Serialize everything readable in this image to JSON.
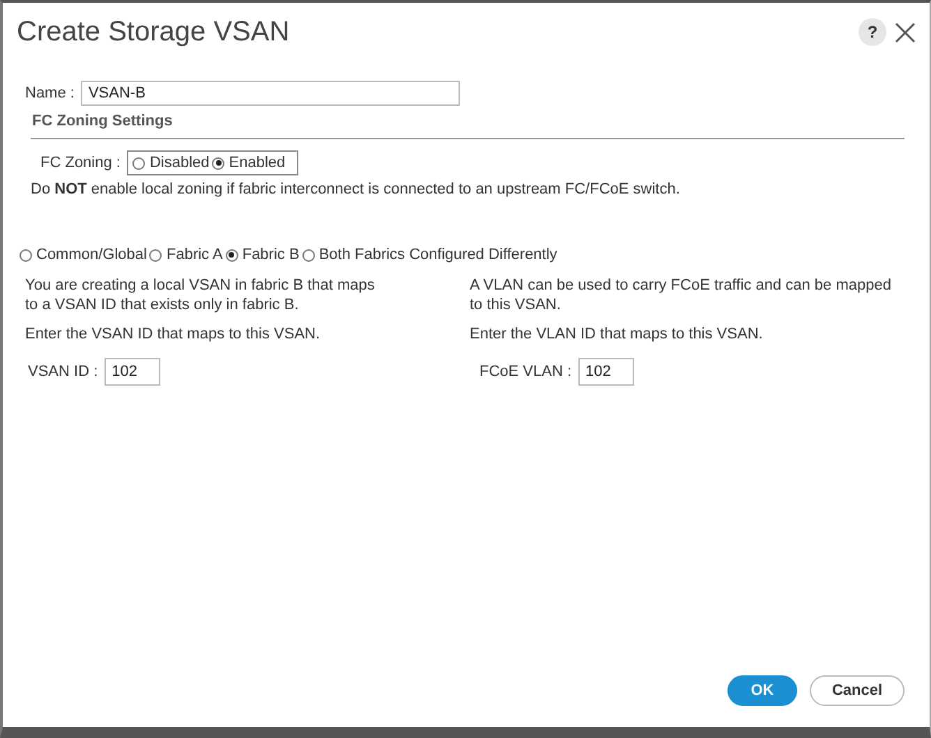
{
  "window": {
    "title": "Create Storage VSAN",
    "help": "?"
  },
  "name_field": {
    "label": "Name :",
    "value": "VSAN-B"
  },
  "section_title": "FC Zoning Settings",
  "fc_zoning": {
    "label": "FC Zoning :",
    "options": [
      {
        "label": "Disabled",
        "selected": false
      },
      {
        "label": "Enabled",
        "selected": true
      }
    ]
  },
  "note": "Do **NOT** enable local zoning if fabric interconnect is connected to an upstream FC/FCoE switch.",
  "scope": [
    {
      "label": "Common/Global",
      "selected": false
    },
    {
      "label": "Fabric A",
      "selected": false
    },
    {
      "label": "Fabric B",
      "selected": true
    },
    {
      "label": "Both Fabrics Configured Differently",
      "selected": false
    }
  ],
  "columns": [
    {
      "description": "You are creating a local VSAN in fabric B that maps to a VSAN ID that exists only in fabric B.",
      "prompt": "Enter the VSAN ID that maps to this VSAN.",
      "field": {
        "label": "VSAN ID :",
        "value": "102"
      }
    },
    {
      "description": "A VLAN can be used to carry FCoE traffic and can be mapped to this VSAN.",
      "prompt": "Enter the VLAN ID that maps to this VSAN.",
      "field": {
        "label": "FCoE VLAN :",
        "value": "102"
      }
    }
  ],
  "buttons": [
    {
      "label": "OK",
      "kind": "primary"
    },
    {
      "label": "Cancel",
      "kind": "secondary"
    }
  ]
}
